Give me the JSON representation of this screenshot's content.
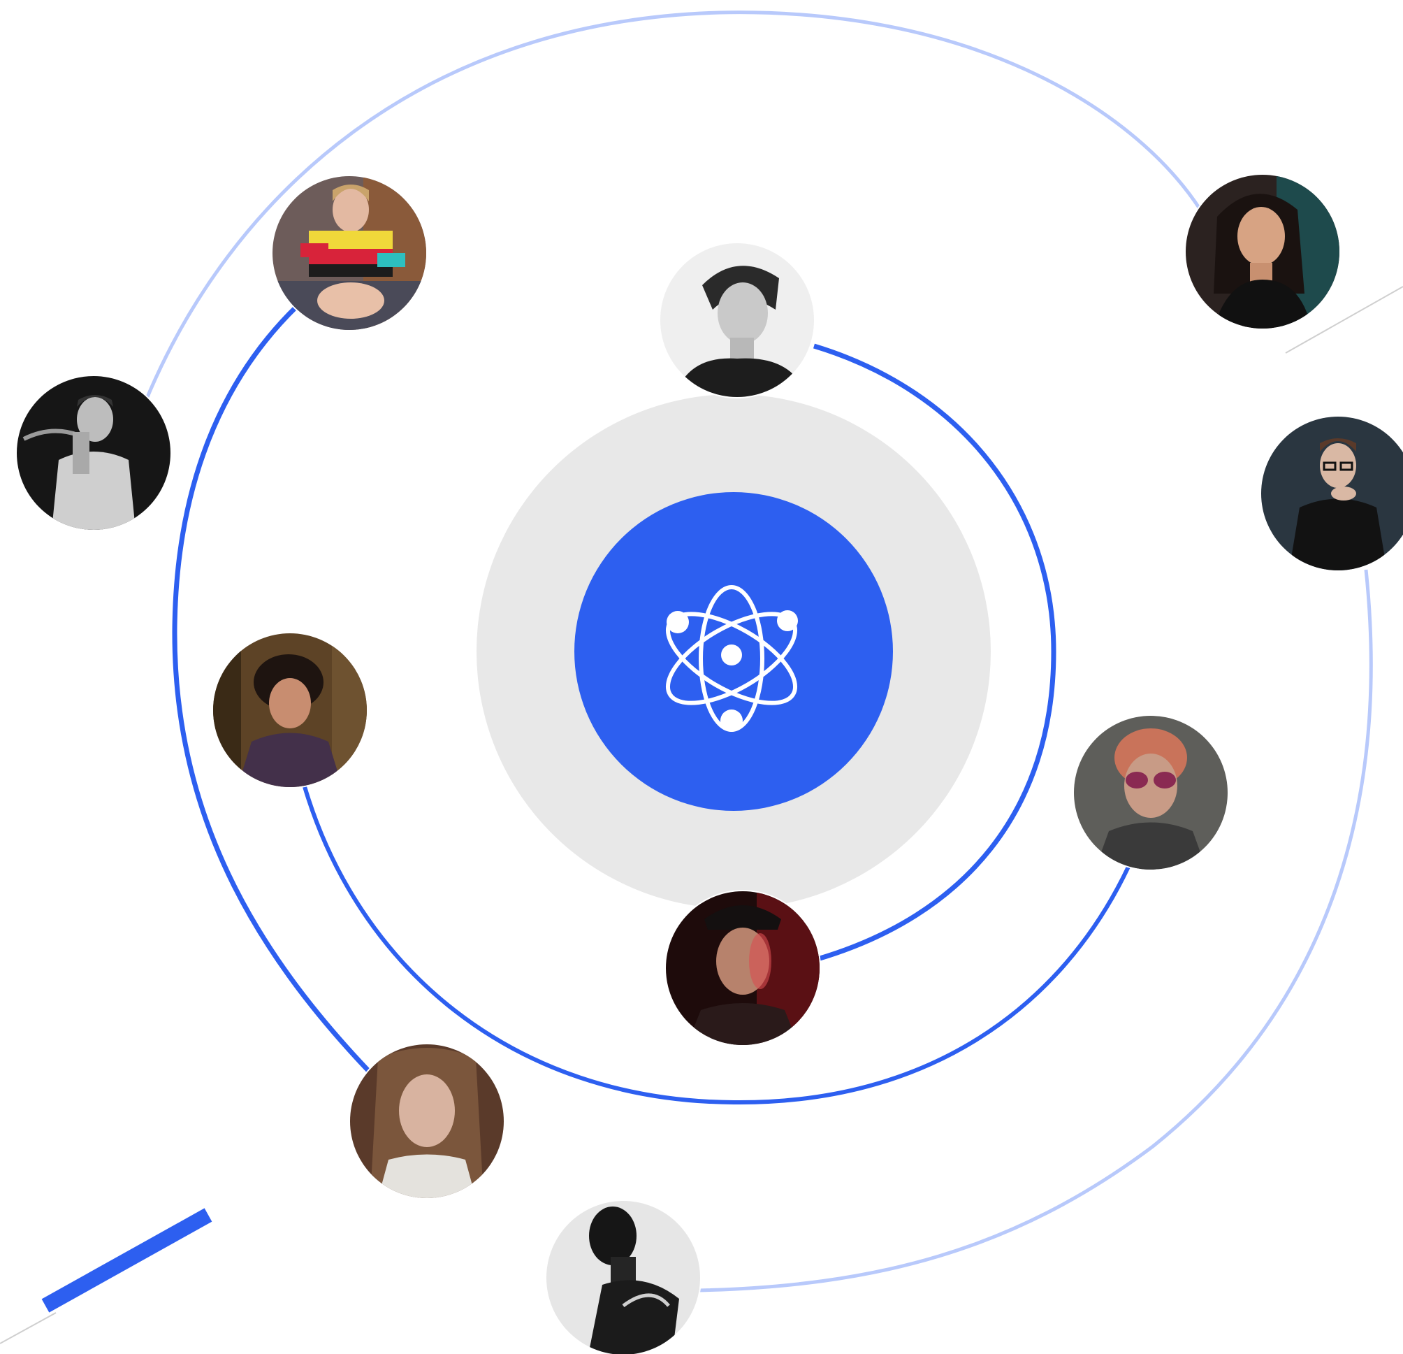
{
  "colors": {
    "accent": "#2d5ff0",
    "accent_light": "#b8c9fb",
    "halo": "#e8e8e8",
    "background": "#ffffff",
    "icon": "#ffffff"
  },
  "hub": {
    "icon": "atom-icon"
  },
  "avatars": [
    {
      "name": "avatar-woman-colorful-sweater",
      "icon": "person-photo",
      "tone": "color"
    },
    {
      "name": "avatar-woman-short-hair",
      "icon": "person-photo",
      "tone": "grayscale"
    },
    {
      "name": "avatar-woman-dark-hair",
      "icon": "person-photo",
      "tone": "color"
    },
    {
      "name": "avatar-man-smoking",
      "icon": "person-photo",
      "tone": "grayscale"
    },
    {
      "name": "avatar-man-glasses",
      "icon": "person-photo",
      "tone": "color"
    },
    {
      "name": "avatar-man-curly-hair",
      "icon": "person-photo",
      "tone": "color"
    },
    {
      "name": "avatar-man-sunglasses",
      "icon": "person-photo",
      "tone": "color"
    },
    {
      "name": "avatar-man-red-light",
      "icon": "person-photo",
      "tone": "color"
    },
    {
      "name": "avatar-woman-long-hair",
      "icon": "person-photo",
      "tone": "color"
    },
    {
      "name": "avatar-man-profile",
      "icon": "person-photo",
      "tone": "grayscale"
    }
  ]
}
